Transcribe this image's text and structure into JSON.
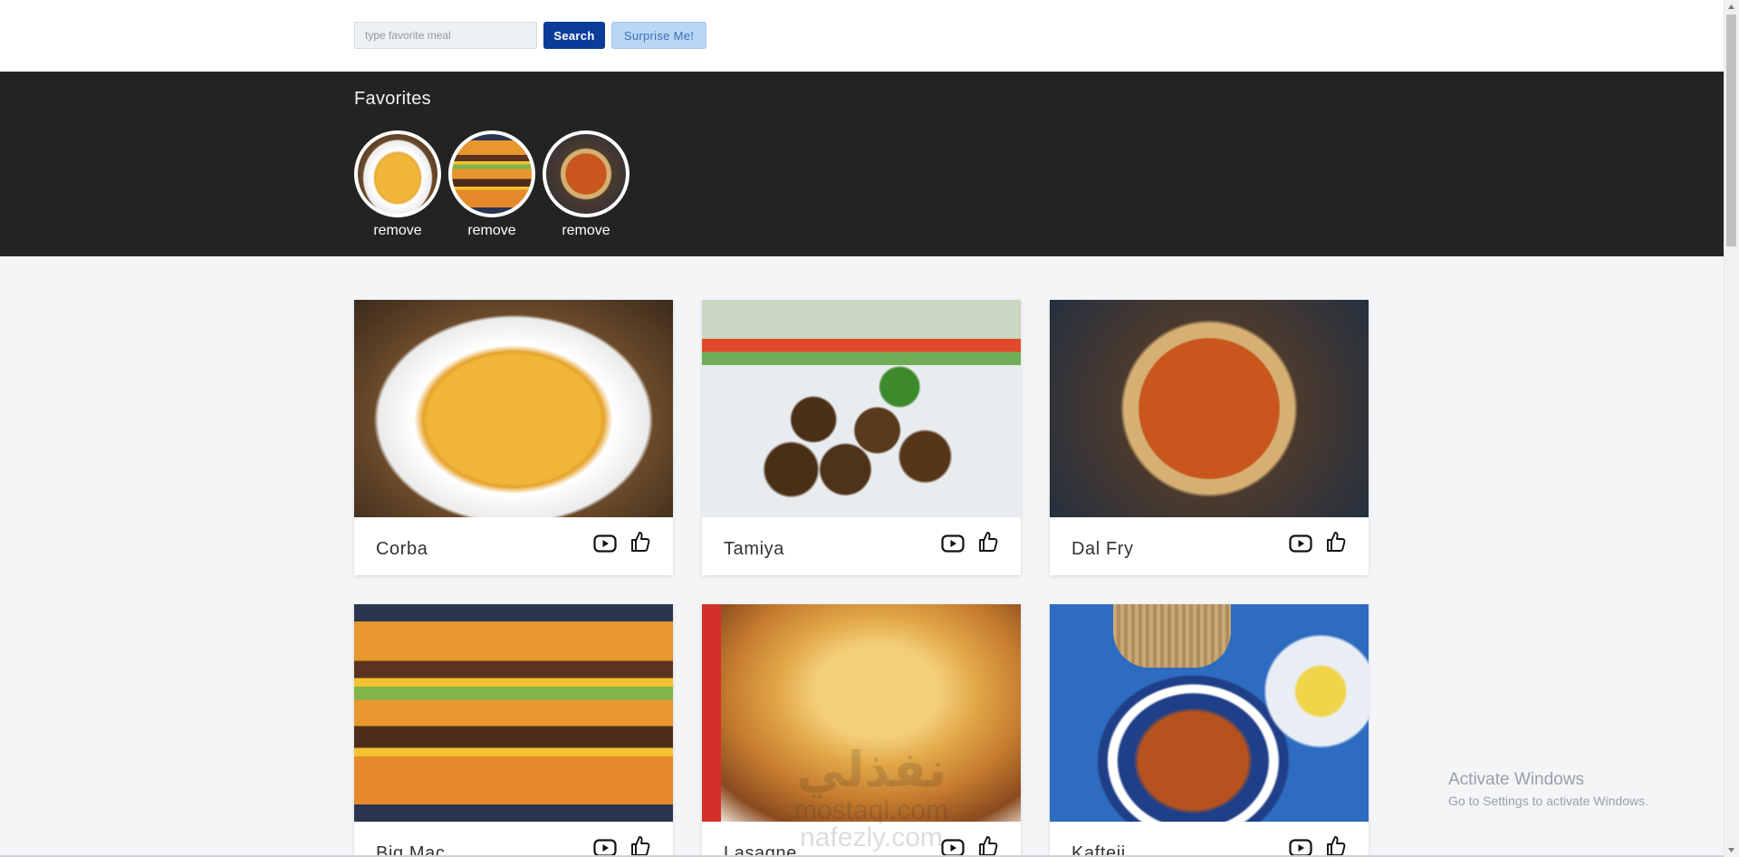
{
  "search": {
    "placeholder": "type favorite meal",
    "value": "",
    "search_label": "Search",
    "surprise_label": "Surprise Me!"
  },
  "favorites": {
    "title": "Favorites",
    "items": [
      {
        "image": "lentil-soup",
        "remove_label": "remove"
      },
      {
        "image": "burger",
        "remove_label": "remove"
      },
      {
        "image": "dal-fry",
        "remove_label": "remove"
      }
    ]
  },
  "meals": [
    {
      "name": "Corba",
      "image": "lentil-soup"
    },
    {
      "name": "Tamiya",
      "image": "falafel"
    },
    {
      "name": "Dal Fry",
      "image": "dal-fry"
    },
    {
      "name": "Big Mac",
      "image": "burger"
    },
    {
      "name": "Lasagne",
      "image": "lasagne"
    },
    {
      "name": "Kafteji",
      "image": "kafteji"
    }
  ],
  "icons": {
    "video": "youtube-icon",
    "like": "thumbs-up-icon"
  },
  "overlay": {
    "activate_title": "Activate Windows",
    "activate_sub": "Go to Settings to activate Windows.",
    "watermark_brand": "نفذلي",
    "watermark_line1": "mostaql.com",
    "watermark_line2": "nafezly.com"
  },
  "colors": {
    "search_button": "#0c3c9a",
    "surprise_button": "#b9d6f5",
    "favorites_band": "#232323",
    "page_background": "#f3f5f7"
  }
}
